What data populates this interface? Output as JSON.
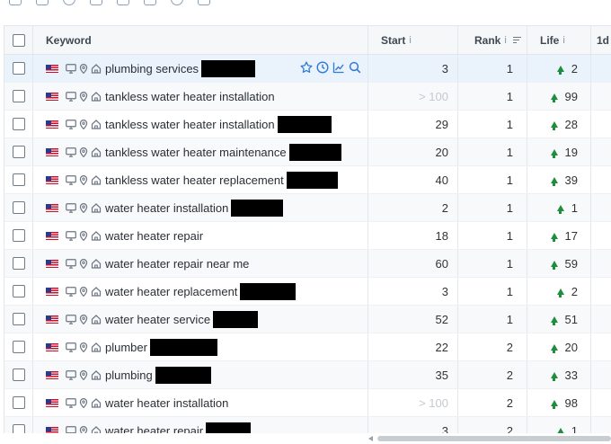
{
  "header": {
    "keyword": "Keyword",
    "start": "Start",
    "rank": "Rank",
    "life": "Life",
    "extra": "1d",
    "info": "i"
  },
  "colors": {
    "up_arrow": "#1e8e3e",
    "action_icons": "#2f7bd8",
    "muted": "#c4c9cf"
  },
  "rows": [
    {
      "keyword": "plumbing services",
      "start": "3",
      "rank": "1",
      "life": "2"
    },
    {
      "keyword": "tankless water heater installation",
      "start": "> 100",
      "rank": "1",
      "life": "99"
    },
    {
      "keyword": "tankless water heater installation",
      "start": "29",
      "rank": "1",
      "life": "28"
    },
    {
      "keyword": "tankless water heater maintenance",
      "start": "20",
      "rank": "1",
      "life": "19"
    },
    {
      "keyword": "tankless water heater replacement",
      "start": "40",
      "rank": "1",
      "life": "39"
    },
    {
      "keyword": "water heater installation",
      "start": "2",
      "rank": "1",
      "life": "1"
    },
    {
      "keyword": "water heater repair",
      "start": "18",
      "rank": "1",
      "life": "17"
    },
    {
      "keyword": "water heater repair near me",
      "start": "60",
      "rank": "1",
      "life": "59"
    },
    {
      "keyword": "water heater replacement",
      "start": "3",
      "rank": "1",
      "life": "2"
    },
    {
      "keyword": "water heater service",
      "start": "52",
      "rank": "1",
      "life": "51"
    },
    {
      "keyword": "plumber",
      "start": "22",
      "rank": "2",
      "life": "20"
    },
    {
      "keyword": "plumbing",
      "start": "35",
      "rank": "2",
      "life": "33"
    },
    {
      "keyword": "water heater installation",
      "start": "> 100",
      "rank": "2",
      "life": "98"
    },
    {
      "keyword": "water heater repair",
      "start": "3",
      "rank": "2",
      "life": "1"
    }
  ]
}
